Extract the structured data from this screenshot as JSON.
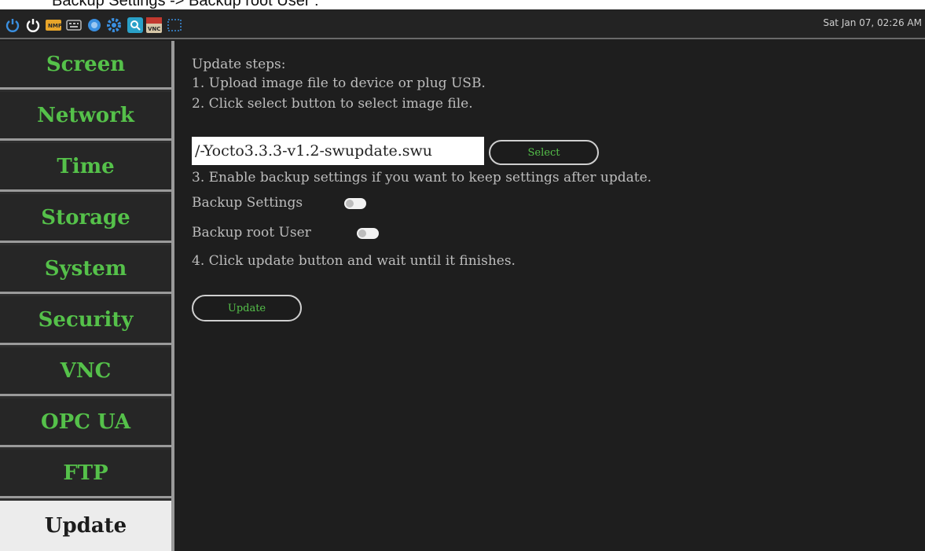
{
  "caption": "Backup Settings -> Backup root User :",
  "taskbar": {
    "icons": [
      "power-icon",
      "restart-icon",
      "nmp-icon",
      "keyboard-icon",
      "browser-icon",
      "settings-icon",
      "search-app-icon",
      "vnc-icon",
      "screenshot-icon"
    ],
    "vnc_icon_text": "VNC",
    "clock": "Sat Jan 07, 02:26 AM"
  },
  "sidebar": {
    "items": [
      {
        "label": "Screen"
      },
      {
        "label": "Network"
      },
      {
        "label": "Time"
      },
      {
        "label": "Storage"
      },
      {
        "label": "System"
      },
      {
        "label": "Security"
      },
      {
        "label": "VNC"
      },
      {
        "label": "OPC UA"
      },
      {
        "label": "FTP"
      },
      {
        "label": "Update",
        "active": true
      }
    ]
  },
  "content": {
    "heading": "Update steps:",
    "step1": "1. Upload image file to device or plug USB.",
    "step2": "2. Click select button to select image file.",
    "file_value": "/-Yocto3.3.3-v1.2-swupdate.swu",
    "select_label": "Select",
    "step3": "3. Enable backup settings if you want to keep settings after update.",
    "backup_settings_label": "Backup Settings",
    "backup_settings_on": false,
    "backup_root_label": "Backup root User",
    "backup_root_on": false,
    "step4": "4. Click update button and wait until it finishes.",
    "update_label": "Update"
  },
  "colors": {
    "accent": "#55c14a",
    "background": "#1e1e1e",
    "sidebar": "#262626"
  }
}
